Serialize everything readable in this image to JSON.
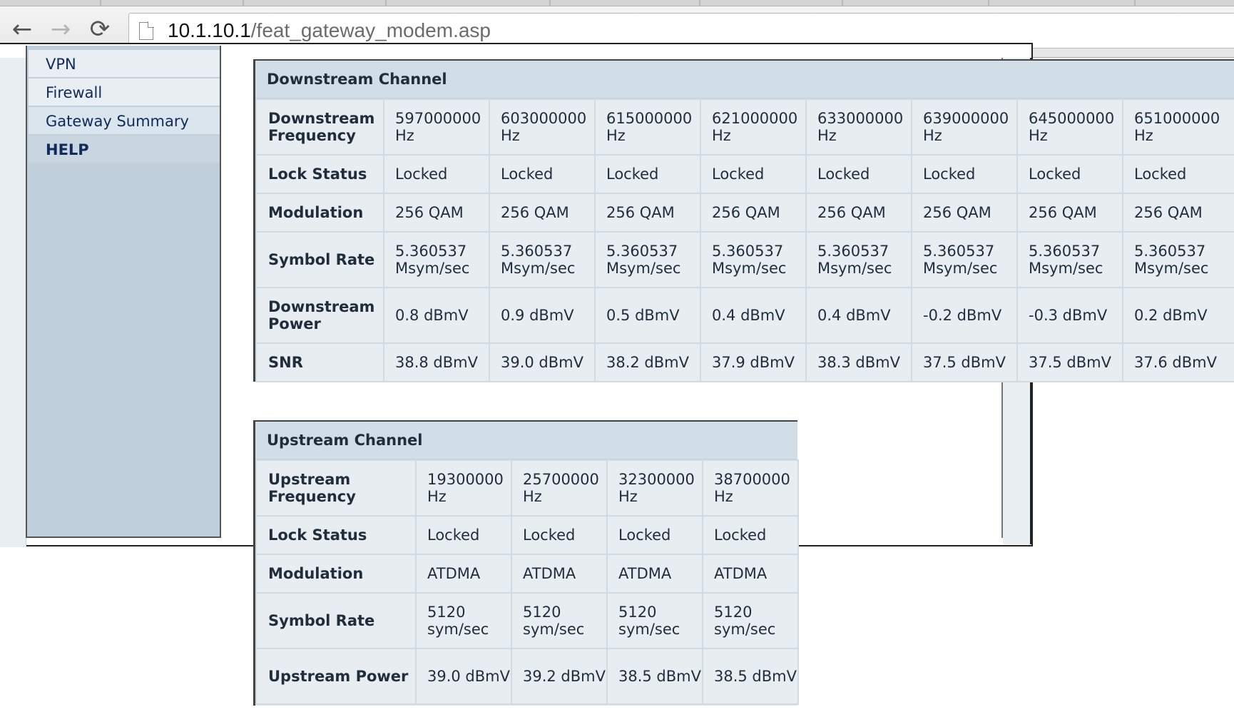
{
  "browser": {
    "url_host": "10.1.10.1",
    "url_path": "/feat_gateway_modem.asp",
    "back_icon": "←",
    "forward_icon": "→",
    "reload_icon": "⟳"
  },
  "sidebar": {
    "items": [
      {
        "label": "VPN"
      },
      {
        "label": "Firewall"
      },
      {
        "label": "Gateway Summary"
      },
      {
        "label": "HELP"
      }
    ]
  },
  "downstream": {
    "title": "Downstream Channel",
    "rows": [
      {
        "label": "Downstream Frequency",
        "values": [
          "597000000 Hz",
          "603000000 Hz",
          "615000000 Hz",
          "621000000 Hz",
          "633000000 Hz",
          "639000000 Hz",
          "645000000 Hz",
          "651000000 Hz"
        ]
      },
      {
        "label": "Lock Status",
        "values": [
          "Locked",
          "Locked",
          "Locked",
          "Locked",
          "Locked",
          "Locked",
          "Locked",
          "Locked"
        ]
      },
      {
        "label": "Modulation",
        "values": [
          "256 QAM",
          "256 QAM",
          "256 QAM",
          "256 QAM",
          "256 QAM",
          "256 QAM",
          "256 QAM",
          "256 QAM"
        ]
      },
      {
        "label": "Symbol Rate",
        "values": [
          "5.360537 Msym/sec",
          "5.360537 Msym/sec",
          "5.360537 Msym/sec",
          "5.360537 Msym/sec",
          "5.360537 Msym/sec",
          "5.360537 Msym/sec",
          "5.360537 Msym/sec",
          "5.360537 Msym/sec"
        ]
      },
      {
        "label": "Downstream Power",
        "values": [
          "0.8 dBmV",
          "0.9 dBmV",
          "0.5 dBmV",
          "0.4 dBmV",
          "0.4 dBmV",
          "-0.2 dBmV",
          "-0.3 dBmV",
          "0.2 dBmV"
        ]
      },
      {
        "label": "SNR",
        "values": [
          "38.8 dBmV",
          "39.0 dBmV",
          "38.2 dBmV",
          "37.9 dBmV",
          "38.3 dBmV",
          "37.5 dBmV",
          "37.5 dBmV",
          "37.6 dBmV"
        ]
      }
    ]
  },
  "upstream": {
    "title": "Upstream Channel",
    "rows": [
      {
        "label": "Upstream Frequency",
        "values": [
          "19300000 Hz",
          "25700000 Hz",
          "32300000 Hz",
          "38700000 Hz"
        ]
      },
      {
        "label": "Lock Status",
        "values": [
          "Locked",
          "Locked",
          "Locked",
          "Locked"
        ]
      },
      {
        "label": "Modulation",
        "values": [
          "ATDMA",
          "ATDMA",
          "ATDMA",
          "ATDMA"
        ]
      },
      {
        "label": "Symbol Rate",
        "values": [
          "5120 sym/sec",
          "5120 sym/sec",
          "5120 sym/sec",
          "5120 sym/sec"
        ]
      },
      {
        "label": "Upstream Power",
        "values": [
          "39.0 dBmV",
          "39.2 dBmV",
          "38.5 dBmV",
          "38.5 dBmV"
        ]
      }
    ]
  }
}
